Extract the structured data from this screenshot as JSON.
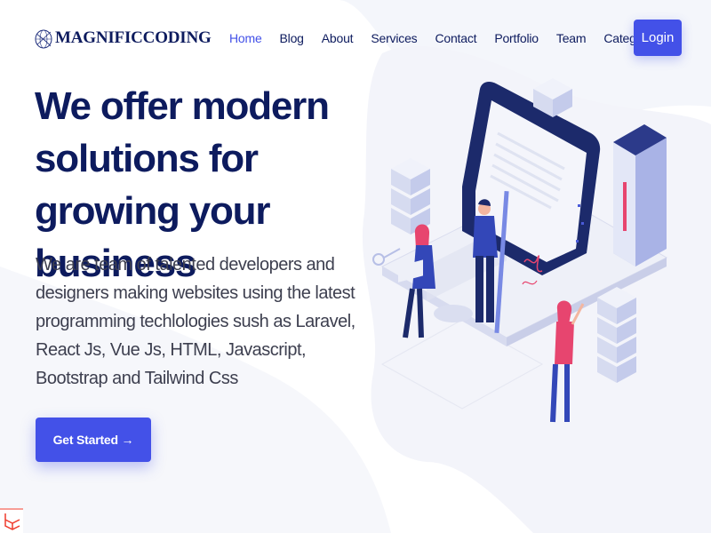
{
  "brand": {
    "name": "MAGNIFICCODING"
  },
  "nav": {
    "items": [
      {
        "label": "Home"
      },
      {
        "label": "Blog"
      },
      {
        "label": "About"
      },
      {
        "label": "Services"
      },
      {
        "label": "Contact"
      },
      {
        "label": "Portfolio"
      },
      {
        "label": "Team"
      },
      {
        "label": "Categories"
      }
    ],
    "active": "Home",
    "login_label": "Login"
  },
  "hero": {
    "title": "We offer modern solutions for growing your business",
    "description": "We are team of talented developers and designers making websites using the latest programming techlologies sush as Laravel, React Js, Vue Js, HTML, Javascript, Bootstrap and Tailwind Css",
    "cta_label": "Get Started →"
  },
  "icons": {
    "categories_dropdown": "chevron-down-icon",
    "corner": "laravel-icon"
  },
  "colors": {
    "primary": "#4351e8",
    "heading": "#0d1b5e",
    "text": "#3d3f4f"
  }
}
